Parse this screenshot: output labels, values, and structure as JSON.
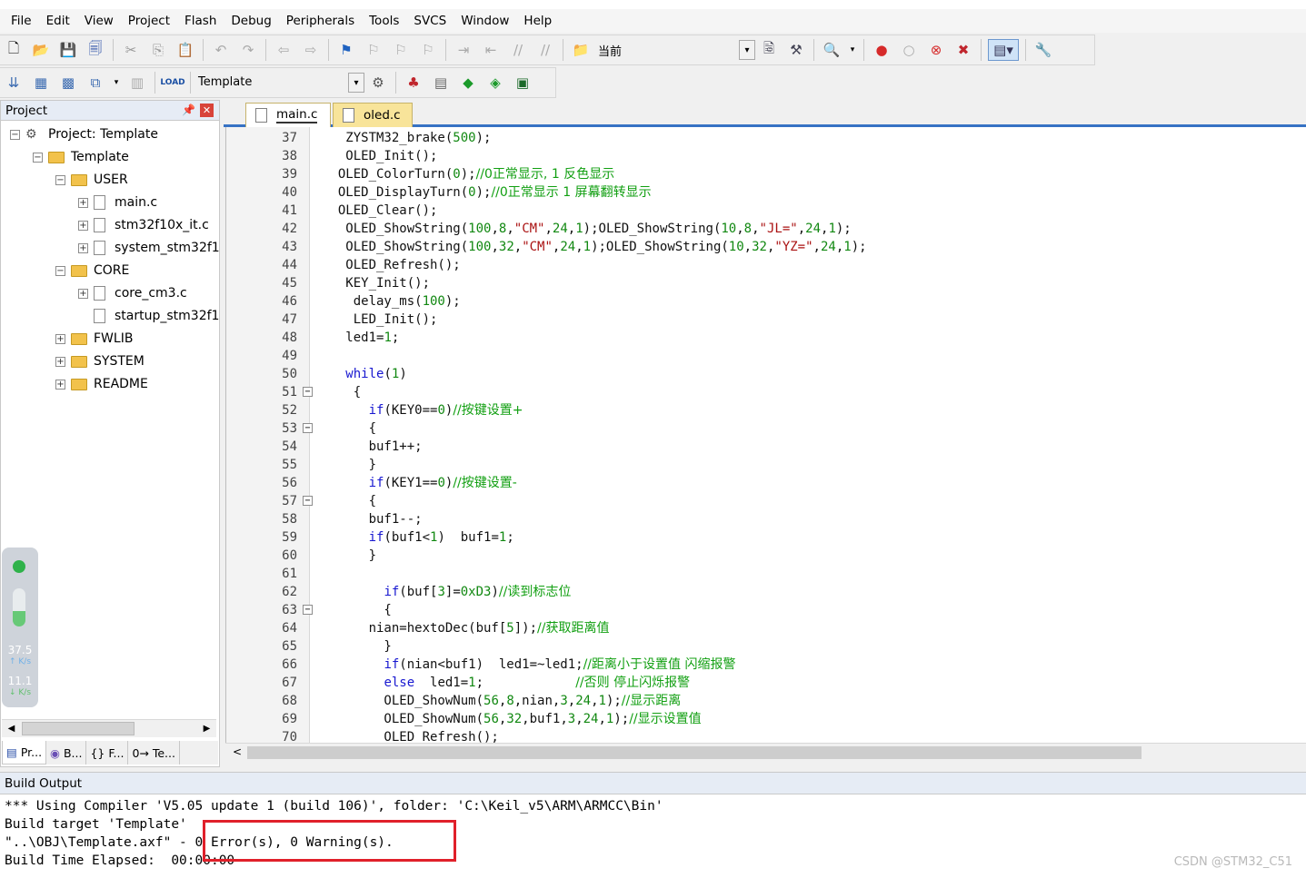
{
  "menu": [
    "File",
    "Edit",
    "View",
    "Project",
    "Flash",
    "Debug",
    "Peripherals",
    "Tools",
    "SVCS",
    "Window",
    "Help"
  ],
  "toolbar": {
    "find_combo_value": "当前",
    "target_combo_value": "Template"
  },
  "project_panel": {
    "title": "Project",
    "tree": [
      {
        "label": "Project: Template"
      },
      {
        "label": "Template"
      },
      {
        "label": "USER"
      },
      {
        "label": "main.c"
      },
      {
        "label": "stm32f10x_it.c"
      },
      {
        "label": "system_stm32f1"
      },
      {
        "label": "CORE"
      },
      {
        "label": "core_cm3.c"
      },
      {
        "label": "startup_stm32f1"
      },
      {
        "label": "FWLIB"
      },
      {
        "label": "SYSTEM"
      },
      {
        "label": "README"
      }
    ],
    "bottom_tabs": [
      "Pr...",
      "B...",
      "{} F...",
      "0→ Te..."
    ]
  },
  "net_widget": {
    "up_value": "37.5",
    "up_unit": "K/s",
    "down_value": "11.1",
    "down_unit": "K/s"
  },
  "editor": {
    "tabs": [
      "main.c",
      "oled.c"
    ],
    "active_tab": "main.c"
  },
  "build_output": {
    "title": "Build Output",
    "lines": [
      "*** Using Compiler 'V5.05 update 1 (build 106)', folder: 'C:\\Keil_v5\\ARM\\ARMCC\\Bin'",
      "Build target 'Template'",
      "\"..\\OBJ\\Template.axf\" - 0 Error(s), 0 Warning(s).",
      "Build Time Elapsed:  00:00:00"
    ]
  },
  "watermark": "CSDN @STM32_C51",
  "colors": {
    "keyword": "#1818d0",
    "number": "#118811",
    "comment": "#119f11",
    "string": "#aa1111",
    "highlight_box": "#e0202a"
  }
}
